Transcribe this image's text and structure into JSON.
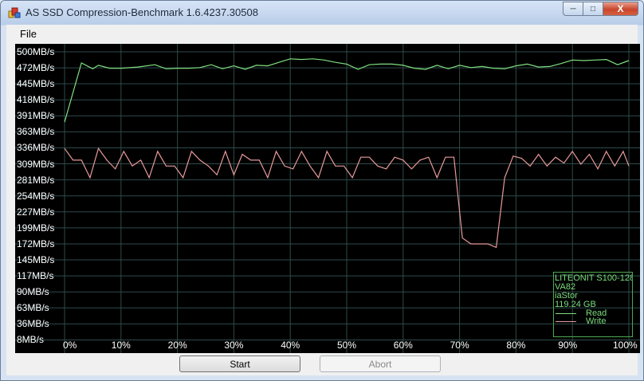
{
  "window": {
    "title": "AS SSD Compression-Benchmark 1.6.4237.30508",
    "min_label": "─",
    "max_label": "□",
    "close_label": "X"
  },
  "menu": {
    "file": "File"
  },
  "chart_data": {
    "type": "line",
    "y_tick_labels": [
      "500MB/s",
      "472MB/s",
      "445MB/s",
      "418MB/s",
      "391MB/s",
      "363MB/s",
      "336MB/s",
      "309MB/s",
      "281MB/s",
      "254MB/s",
      "227MB/s",
      "199MB/s",
      "172MB/s",
      "145MB/s",
      "117MB/s",
      "90MB/s",
      "63MB/s",
      "36MB/s",
      "8MB/s"
    ],
    "x_tick_labels": [
      "0%",
      "10%",
      "20%",
      "30%",
      "40%",
      "50%",
      "60%",
      "70%",
      "80%",
      "90%",
      "100%"
    ],
    "ylim": [
      8,
      500
    ],
    "xlim": [
      0,
      100
    ],
    "grid": true,
    "legend_position": "bottom-right",
    "series": [
      {
        "name": "Read",
        "color": "#7fe07f",
        "x": [
          0,
          3,
          5,
          6,
          8,
          10,
          13,
          16,
          18,
          20,
          22,
          24,
          26,
          28,
          30,
          32,
          34,
          36,
          38,
          40,
          42,
          44,
          46,
          48,
          50,
          52,
          54,
          56,
          58,
          60,
          62,
          64,
          66,
          68,
          70,
          72,
          74,
          76,
          78,
          80,
          82,
          84,
          86,
          88,
          90,
          92,
          94,
          96,
          98,
          100
        ],
        "y": [
          380,
          481,
          471,
          477,
          472,
          472,
          474,
          478,
          471,
          472,
          472,
          473,
          478,
          471,
          476,
          470,
          477,
          476,
          482,
          488,
          487,
          488,
          486,
          482,
          479,
          470,
          478,
          479,
          479,
          477,
          472,
          470,
          477,
          471,
          477,
          473,
          475,
          472,
          471,
          476,
          479,
          474,
          475,
          480,
          486,
          485,
          486,
          487,
          478,
          485
        ]
      },
      {
        "name": "Write",
        "color": "#e89a9a",
        "x": [
          0,
          1.5,
          3,
          4.5,
          6,
          7.5,
          9,
          10.5,
          12,
          13.5,
          15,
          16.5,
          18,
          19.5,
          21,
          22.5,
          24,
          25.5,
          27,
          28.5,
          30,
          31.5,
          33,
          34.5,
          36,
          37.5,
          39,
          40.5,
          42,
          43.5,
          45,
          46.5,
          48,
          49.5,
          51,
          52.5,
          54,
          55.5,
          57,
          58.5,
          60,
          61.5,
          63,
          64.5,
          66,
          67.5,
          69,
          70.5,
          72,
          73.5,
          75,
          76.5,
          78,
          79.5,
          81,
          82.5,
          84,
          85.5,
          87,
          88.5,
          90,
          91.5,
          93,
          94.5,
          96,
          97.5,
          99,
          100
        ],
        "y": [
          335,
          315,
          315,
          285,
          335,
          315,
          300,
          330,
          305,
          315,
          285,
          330,
          305,
          305,
          285,
          330,
          315,
          305,
          290,
          330,
          290,
          325,
          315,
          315,
          285,
          330,
          305,
          300,
          330,
          305,
          285,
          330,
          305,
          305,
          285,
          320,
          320,
          305,
          300,
          320,
          315,
          300,
          315,
          320,
          285,
          320,
          320,
          182,
          172,
          172,
          172,
          166,
          285,
          322,
          318,
          305,
          325,
          305,
          320,
          310,
          330,
          308,
          325,
          300,
          330,
          305,
          330,
          305
        ]
      }
    ]
  },
  "drive_info": {
    "model": "LITEONIT S100-128",
    "firmware": "VA82",
    "driver": "iaStor",
    "capacity": "119.24 GB",
    "legend_read": "Read",
    "legend_write": "Write",
    "read_color": "#7fe07f",
    "write_color": "#e89a9a"
  },
  "buttons": {
    "start": "Start",
    "abort": "Abort"
  }
}
